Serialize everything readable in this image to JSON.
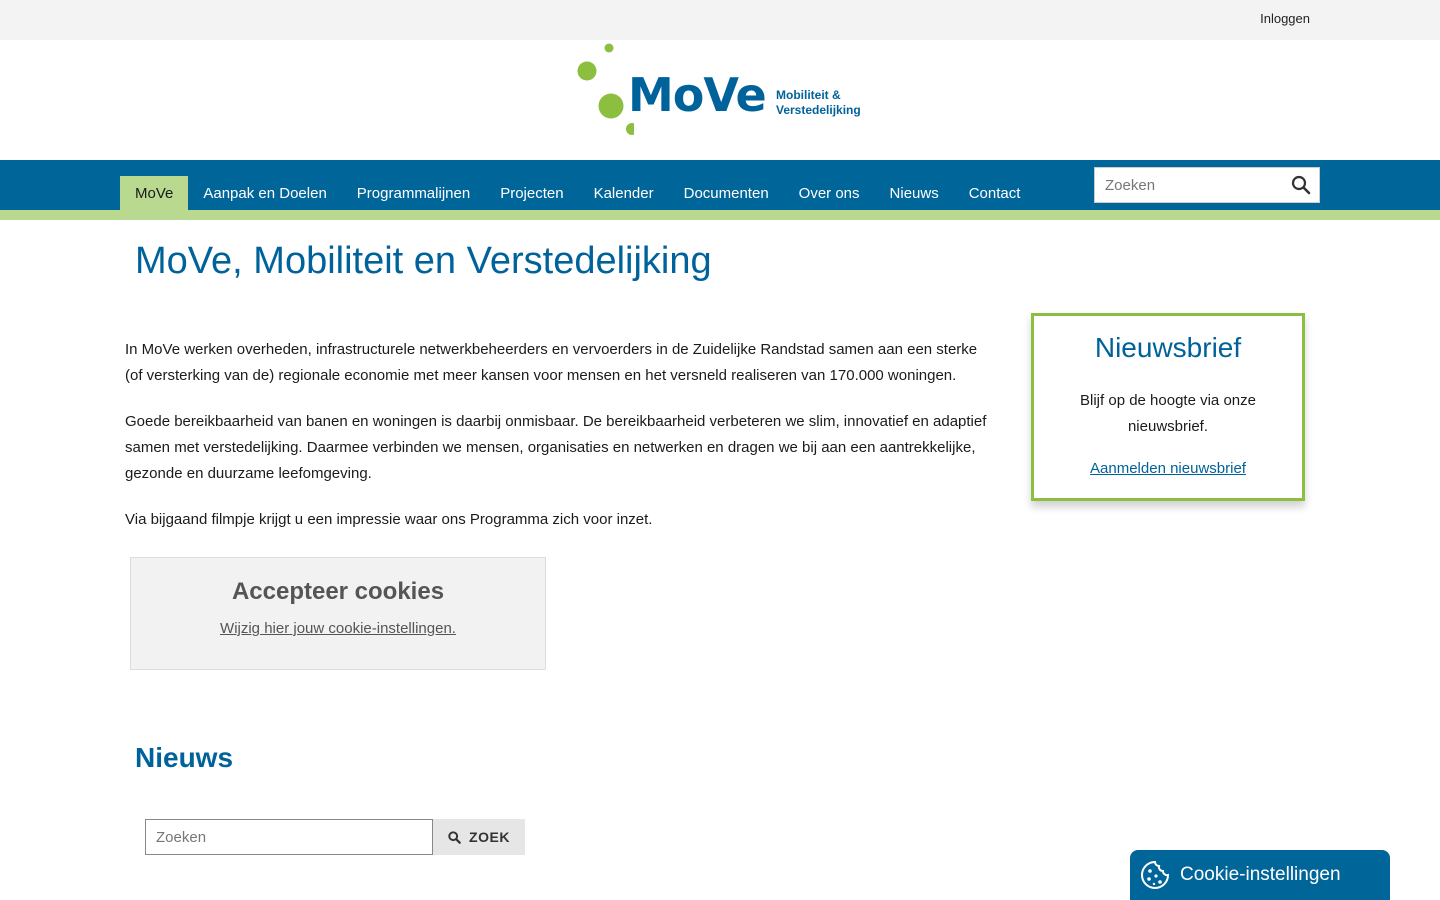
{
  "topbar": {
    "login_label": "Inloggen"
  },
  "logo": {
    "word": "MoVe",
    "subtitle_line1": "Mobiliteit &",
    "subtitle_line2": "Verstedelijking"
  },
  "colors": {
    "brand_blue": "#006599",
    "brand_green": "#8cbe3f",
    "light_green": "#b8d98f"
  },
  "nav": {
    "items": [
      {
        "label": "MoVe",
        "active": true
      },
      {
        "label": "Aanpak en Doelen"
      },
      {
        "label": "Programmalijnen"
      },
      {
        "label": "Projecten"
      },
      {
        "label": "Kalender"
      },
      {
        "label": "Documenten"
      },
      {
        "label": "Over ons"
      },
      {
        "label": "Nieuws"
      },
      {
        "label": "Contact"
      }
    ],
    "search_placeholder": "Zoeken",
    "search_icon": "search-icon"
  },
  "main": {
    "title": "MoVe, Mobiliteit en Verstedelijking",
    "paragraphs": [
      "In MoVe werken overheden, infrastructurele netwerkbeheerders  en vervoerders in de Zuidelijke Randstad samen aan een sterke (of versterking van de) regionale economie met meer kansen voor mensen en het versneld realiseren van 170.000 woningen.",
      "Goede bereikbaarheid van banen en woningen is daarbij onmisbaar. De bereikbaarheid verbeteren we slim, innovatief en adaptief samen met verstedelijking. Daarmee verbinden we mensen, organisaties en netwerken en dragen we bij aan een aantrekkelijke, gezonde en duurzame leefomgeving.",
      "Via bijgaand filmpje krijgt u een impressie waar ons Programma zich voor inzet."
    ]
  },
  "cookie_box": {
    "title": "Accepteer cookies",
    "link": "Wijzig hier jouw cookie-instellingen."
  },
  "newsletter": {
    "title": "Nieuwsbrief",
    "text": "Blijf op de hoogte via onze nieuwsbrief.",
    "link": "Aanmelden nieuwsbrief"
  },
  "news": {
    "heading": "Nieuws",
    "search_placeholder": "Zoeken",
    "search_button": "ZOEK"
  },
  "cookie_settings": {
    "label": "Cookie-instellingen",
    "icon": "cookie-icon"
  }
}
